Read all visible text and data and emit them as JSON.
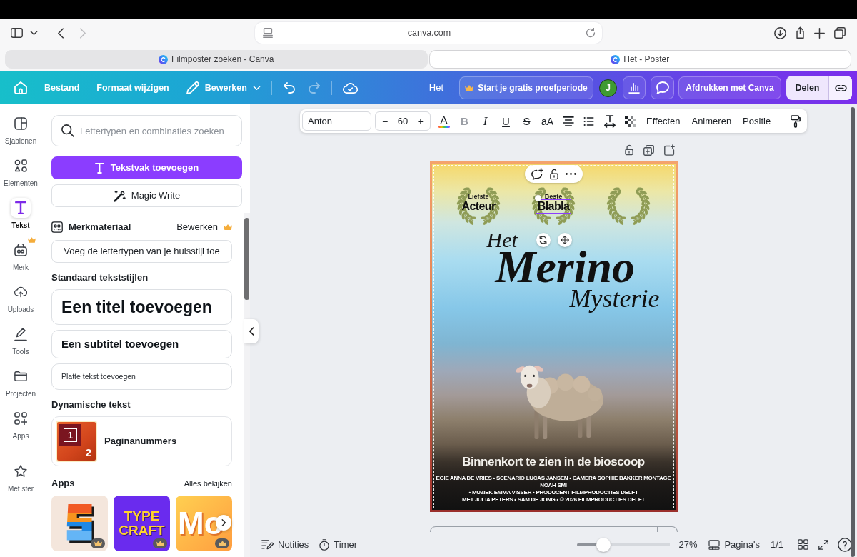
{
  "browser": {
    "navigation": {
      "back_disabled": false,
      "forward_disabled": true
    },
    "address": "canva.com",
    "tabs": [
      {
        "title": "Filmposter zoeken - Canva",
        "selected": false
      },
      {
        "title": "Het - Poster",
        "selected": true
      }
    ]
  },
  "editor_bar": {
    "menus": [
      {
        "kind": "plain",
        "label": "Bestand"
      },
      {
        "kind": "plain",
        "label": "Formaat wijzigen"
      },
      {
        "kind": "dropdown",
        "label": "Bewerken"
      }
    ],
    "undo": {
      "disabled": false
    },
    "redo": {
      "disabled": true
    },
    "document_title": "Het",
    "trial_button": "Start je gratis proefperiode",
    "avatar": "J",
    "print_button": "Afdrukken met Canva",
    "share_button": "Delen"
  },
  "text_toolbar": {
    "font": "Anton",
    "size": {
      "decrease": "−",
      "value": "60",
      "increase": "+"
    },
    "color_button": "A",
    "style_buttons": [
      {
        "kind": "bold",
        "glyph": "B",
        "disabled": true
      },
      {
        "kind": "italic",
        "glyph": "I",
        "disabled": false
      },
      {
        "kind": "underline",
        "glyph": "U",
        "disabled": false
      },
      {
        "kind": "strike",
        "glyph": "S",
        "disabled": false
      },
      {
        "kind": "case",
        "glyph": "aA",
        "disabled": false
      }
    ],
    "menus": [
      "Effecten",
      "Animeren",
      "Positie"
    ]
  },
  "rail": [
    {
      "label": "Sjablonen",
      "selected": false,
      "premium": false
    },
    {
      "label": "Elementen",
      "selected": false,
      "premium": false
    },
    {
      "label": "Tekst",
      "selected": true,
      "premium": false
    },
    {
      "label": "Merk",
      "selected": false,
      "premium": true
    },
    {
      "label": "Uploads",
      "selected": false,
      "premium": false
    },
    {
      "label": "Tools",
      "selected": false,
      "premium": false
    },
    {
      "label": "Projecten",
      "selected": false,
      "premium": false
    },
    {
      "label": "Apps",
      "selected": false,
      "premium": false
    },
    {
      "label": "Met ster",
      "selected": false,
      "premium": false
    }
  ],
  "panel": {
    "search": {
      "placeholder": "Lettertypen en combinaties zoeken"
    },
    "add_textbox_button": "Tekstvak toevoegen",
    "magic_write_button": "Magic Write",
    "brand": {
      "title": "Merkmateriaal",
      "action": "Bewerken",
      "premium": true,
      "button": "Voeg de lettertypen van je huisstijl toe"
    },
    "styles_heading": "Standaard tekststijlen",
    "styles": [
      {
        "kind": "title",
        "label": "Een titel toevoegen"
      },
      {
        "kind": "subtitle",
        "label": "Een subtitel toevoegen"
      },
      {
        "kind": "body",
        "label": "Platte tekst toevoegen"
      }
    ],
    "dynamic_heading": "Dynamische tekst",
    "dynamic_items": [
      {
        "label": "Paginanummers",
        "thumb_numbers": [
          "1",
          "2"
        ]
      }
    ],
    "apps_heading": "Apps",
    "apps_link": "Alles bekijken",
    "apps": [
      {
        "kind": "stripes",
        "premium": true
      },
      {
        "kind": "lettering",
        "lines": [
          "TYPE",
          "CRAFT"
        ],
        "premium": true
      },
      {
        "kind": "monogram",
        "lines": [
          "Mo"
        ],
        "premium": true
      }
    ]
  },
  "poster": {
    "selected": true,
    "awards": [
      {
        "line1": "Liefste",
        "line2": "Acteur",
        "selected": false
      },
      {
        "line1": "Beste",
        "line2": "Blabla",
        "selected": true
      },
      {
        "selected": false
      }
    ],
    "title": [
      {
        "kind": "lead",
        "text": "Het"
      },
      {
        "kind": "main",
        "text": "Merino"
      },
      {
        "kind": "tail",
        "text": "Mysterie"
      }
    ],
    "tagline": "Binnenkort te zien in de bioscoop",
    "credits": [
      "EGIE ANNA DE VRIES • SCENARIO LUCAS JANSEN • CAMERA SOPHIE BAKKER MONTAGE NOAH SMI",
      "• MUZIEK EMMA VISSER • PRODUCENT FILMPRODUCTIES DELFT",
      "MET JULIA PETERS • SAM DE JONG • © 2026 FILMPRODUCTIES DELFT"
    ]
  },
  "bottom_bar": {
    "notes": "Notities",
    "timer": "Timer",
    "zoom": {
      "level": 0.28,
      "reading": "27%"
    },
    "pages": "Pagina's",
    "page_count": "1/1"
  }
}
